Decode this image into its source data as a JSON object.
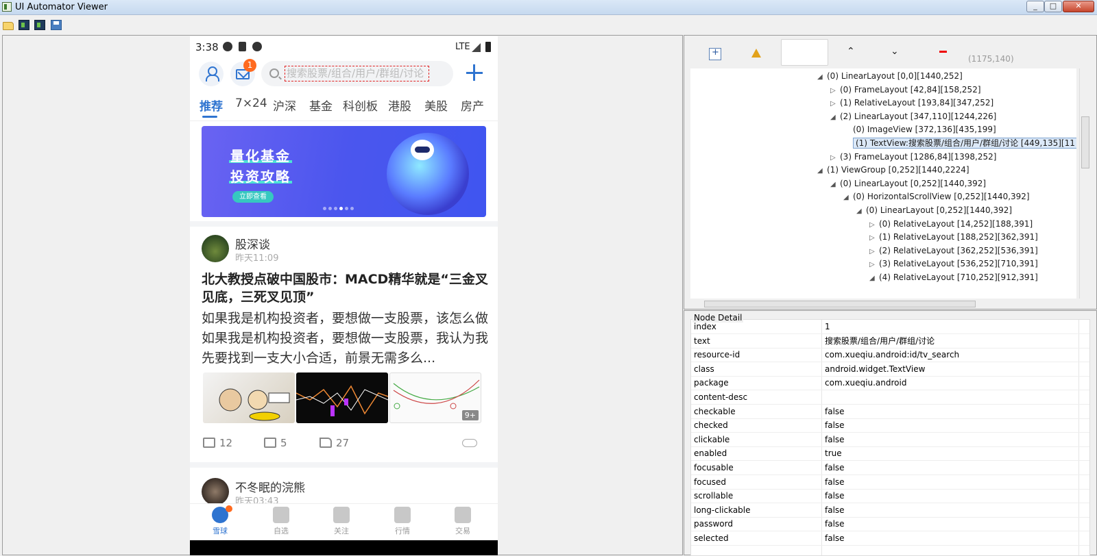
{
  "window": {
    "title": "UI Automator Viewer",
    "min": "_",
    "max": "□",
    "close": "✕"
  },
  "phone": {
    "status": {
      "time": "3:38",
      "network": "LTE"
    },
    "header": {
      "badge": "1",
      "search_placeholder": "搜索股票/组合/用户/群组/讨论"
    },
    "tabs": [
      "推荐",
      "7×24",
      "沪深",
      "基金",
      "科创板",
      "港股",
      "美股",
      "房产"
    ],
    "banner": {
      "line1": "量化基金",
      "line2": "投资攻略",
      "button": "立即查看"
    },
    "post1": {
      "author": "股深谈",
      "time": "昨天11:09",
      "title": "北大教授点破中国股市：MACD精华就是“三金叉见底，三死叉见顶”",
      "body": "如果我是机构投资者，要想做一支股票，该怎么做 如果我是机构投资者，要想做一支股票，我认为我先要找到一支大小合适，前景无需多么...",
      "more_tag": "9+",
      "reposts": "12",
      "comments": "5",
      "likes": "27"
    },
    "post2": {
      "author": "不冬眠的浣熊",
      "time": "昨天03:43"
    },
    "nav": [
      "雪球",
      "自选",
      "关注",
      "行情",
      "交易"
    ]
  },
  "hierarchy": {
    "coords": "(1175,140)",
    "rows": [
      {
        "indent": 0,
        "arrow": "◢",
        "label": "(0) LinearLayout [0,0][1440,252]"
      },
      {
        "indent": 1,
        "arrow": "▷",
        "label": "(0) FrameLayout [42,84][158,252]"
      },
      {
        "indent": 1,
        "arrow": "▷",
        "label": "(1) RelativeLayout [193,84][347,252]"
      },
      {
        "indent": 1,
        "arrow": "◢",
        "label": "(2) LinearLayout [347,110][1244,226]"
      },
      {
        "indent": 2,
        "arrow": "",
        "label": "(0) ImageView [372,136][435,199]"
      },
      {
        "indent": 2,
        "arrow": "",
        "label": "(1) TextView:搜索股票/组合/用户/群组/讨论 [449,135][11",
        "selected": true
      },
      {
        "indent": 1,
        "arrow": "▷",
        "label": "(3) FrameLayout [1286,84][1398,252]"
      },
      {
        "indent": 0,
        "arrow": "◢",
        "label": "(1) ViewGroup [0,252][1440,2224]"
      },
      {
        "indent": 1,
        "arrow": "◢",
        "label": "(0) LinearLayout [0,252][1440,392]"
      },
      {
        "indent": 2,
        "arrow": "◢",
        "label": "(0) HorizontalScrollView [0,252][1440,392]"
      },
      {
        "indent": 3,
        "arrow": "◢",
        "label": "(0) LinearLayout [0,252][1440,392]"
      },
      {
        "indent": 4,
        "arrow": "▷",
        "label": "(0) RelativeLayout [14,252][188,391]"
      },
      {
        "indent": 4,
        "arrow": "▷",
        "label": "(1) RelativeLayout [188,252][362,391]"
      },
      {
        "indent": 4,
        "arrow": "▷",
        "label": "(2) RelativeLayout [362,252][536,391]"
      },
      {
        "indent": 4,
        "arrow": "▷",
        "label": "(3) RelativeLayout [536,252][710,391]"
      },
      {
        "indent": 4,
        "arrow": "◢",
        "label": "(4) RelativeLayout [710,252][912,391]"
      }
    ]
  },
  "detail": {
    "title": "Node Detail",
    "rows": [
      {
        "key": "index",
        "value": "1"
      },
      {
        "key": "text",
        "value": "搜索股票/组合/用户/群组/讨论"
      },
      {
        "key": "resource-id",
        "value": "com.xueqiu.android:id/tv_search"
      },
      {
        "key": "class",
        "value": "android.widget.TextView"
      },
      {
        "key": "package",
        "value": "com.xueqiu.android"
      },
      {
        "key": "content-desc",
        "value": ""
      },
      {
        "key": "checkable",
        "value": "false"
      },
      {
        "key": "checked",
        "value": "false"
      },
      {
        "key": "clickable",
        "value": "false"
      },
      {
        "key": "enabled",
        "value": "true"
      },
      {
        "key": "focusable",
        "value": "false"
      },
      {
        "key": "focused",
        "value": "false"
      },
      {
        "key": "scrollable",
        "value": "false"
      },
      {
        "key": "long-clickable",
        "value": "false"
      },
      {
        "key": "password",
        "value": "false"
      },
      {
        "key": "selected",
        "value": "false"
      }
    ]
  }
}
